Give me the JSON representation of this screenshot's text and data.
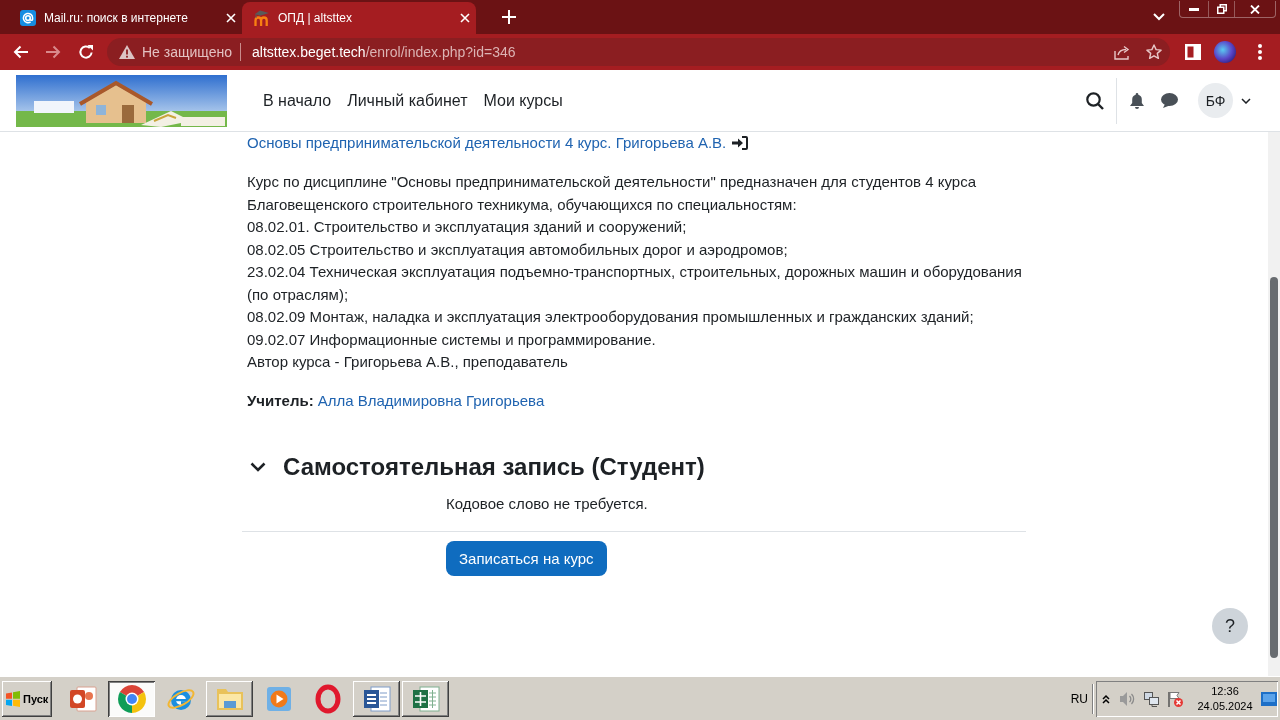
{
  "browser": {
    "tabs": [
      {
        "kind": "mail",
        "title": "Mail.ru: поиск в интернете",
        "selected": false
      },
      {
        "kind": "moodle",
        "title": "ОПД | altsttex",
        "selected": true
      }
    ],
    "forward_disabled": true,
    "address_bar": {
      "security": "Не защищено",
      "host": "altsttex.beget.tech",
      "path": "/enrol/index.php?id=346"
    }
  },
  "site_header": {
    "nav": [
      {
        "label": "В начало"
      },
      {
        "label": "Личный кабинет"
      },
      {
        "label": "Мои курсы"
      }
    ],
    "avatar_initials": "БФ"
  },
  "course": {
    "title": "Основы предпринимательской деятельности 4 курс. Григорьева А.В.",
    "description": [
      "Курс по дисциплине \"Основы предпринимательской деятельности\" предназначен для студентов 4 курса",
      "Благовещенского строительного техникума, обучающихся по специальностям:",
      "08.02.01. Строительство и эксплуатация зданий и сооружений;",
      "08.02.05 Строительство и эксплуатация автомобильных дорог и аэродромов;",
      "23.02.04 Техническая эксплуатация подъемно-транспортных, строительных, дорожных машин и оборудования",
      "(по отраслям);",
      "08.02.09 Монтаж, наладка и эксплуатация электрооборудования промышленных и гражданских зданий;",
      "09.02.07 Информационные системы и программирование.",
      "Автор курса - Григорьева А.В., преподаватель"
    ],
    "teacher_label": "Учитель:",
    "teacher": "Алла Владимировна Григорьева"
  },
  "enrol": {
    "title": "Самостоятельная запись (Студент)",
    "expanded": true,
    "note": "Кодовое слово не требуется.",
    "button": "Записаться на курс"
  },
  "help_button": {
    "label": "?"
  },
  "taskbar": {
    "start": "Пуск",
    "apps": [
      {
        "kind": "presentation",
        "open": false,
        "selected": false
      },
      {
        "kind": "chrome",
        "open": true,
        "selected": true
      },
      {
        "kind": "ie",
        "open": false,
        "selected": false
      },
      {
        "kind": "folder",
        "open": true,
        "selected": false
      },
      {
        "kind": "media",
        "open": false,
        "selected": false
      },
      {
        "kind": "opera",
        "open": false,
        "selected": false
      },
      {
        "kind": "word",
        "open": true,
        "selected": false
      },
      {
        "kind": "excel",
        "open": true,
        "selected": false
      }
    ],
    "language": "RU",
    "time": "12:36",
    "date": "24.05.2024"
  }
}
